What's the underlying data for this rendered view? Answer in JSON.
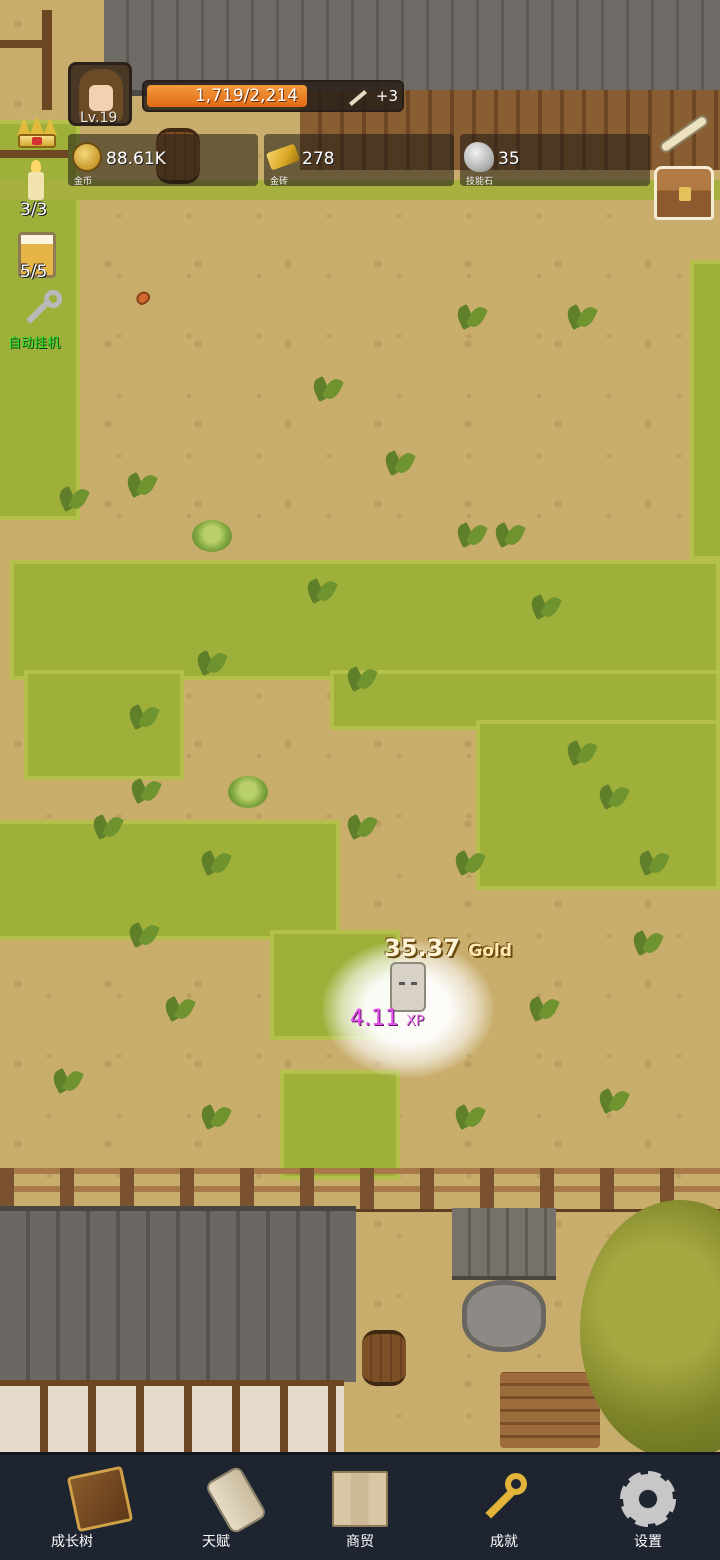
{
  "player": {
    "level": "Lv.19"
  },
  "xp": {
    "current_max": "1,719/2,214",
    "progress": 0.776,
    "bonus": "+3"
  },
  "resources": [
    {
      "value": "88.61K",
      "caption": "金币",
      "icon": "gold-coin-icon"
    },
    {
      "value": "278",
      "caption": "金砖",
      "icon": "gold-brick-icon"
    },
    {
      "value": "35",
      "caption": "技能石",
      "icon": "skill-stone-icon"
    }
  ],
  "side": {
    "candle_count": "3/3",
    "beer_count": "5/5",
    "auto_label": "自动挂机"
  },
  "floating": {
    "gold_value": "35.37",
    "gold_unit": "Gold",
    "xp_value": "4.11",
    "xp_unit": "XP"
  },
  "nav": [
    {
      "label": "成长树",
      "icon": "book-icon"
    },
    {
      "label": "天赋",
      "icon": "scroll-icon"
    },
    {
      "label": "商贸",
      "icon": "map-icon"
    },
    {
      "label": "成就",
      "icon": "key-icon"
    },
    {
      "label": "设置",
      "icon": "gear-icon"
    }
  ],
  "colors": {
    "xp_fill": "#e97a22",
    "auto_label": "#27e02c",
    "xp_text": "#e84ff0",
    "nav_bg": "#1f2530"
  }
}
